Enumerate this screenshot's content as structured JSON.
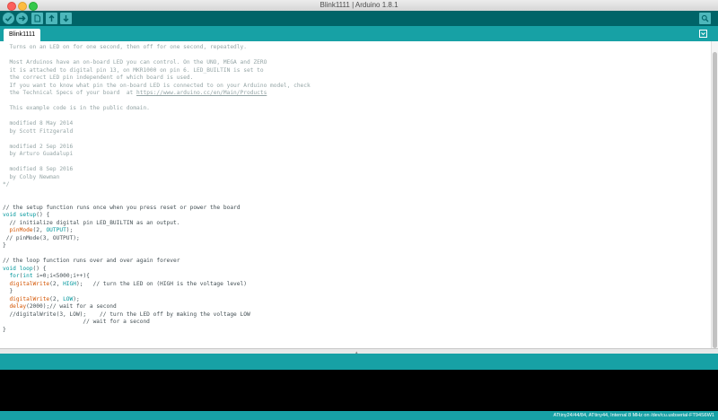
{
  "window": {
    "title": "Blink1111 | Arduino 1.8.1"
  },
  "toolbar": {
    "buttons": [
      {
        "name": "verify",
        "icon": "checkmark-icon"
      },
      {
        "name": "upload",
        "icon": "arrow-right-icon"
      },
      {
        "name": "new",
        "icon": "new-file-icon"
      },
      {
        "name": "open",
        "icon": "arrow-up-icon"
      },
      {
        "name": "save",
        "icon": "arrow-down-icon"
      },
      {
        "name": "serial-monitor",
        "icon": "magnifier-icon"
      }
    ]
  },
  "tabs": [
    {
      "label": "Blink1111"
    }
  ],
  "editor": {
    "lines": [
      {
        "segments": [
          {
            "t": "  Turns on an LED on for one second, then off for one second, repeatedly.",
            "c": "comment"
          }
        ]
      },
      {
        "segments": [
          {
            "t": "",
            "c": "comment"
          }
        ]
      },
      {
        "segments": [
          {
            "t": "  Most Arduinos have an on-board LED you can control. On the UNO, MEGA and ZERO",
            "c": "comment"
          }
        ]
      },
      {
        "segments": [
          {
            "t": "  it is attached to digital pin 13, on MKR1000 on pin 6. LED_BUILTIN is set to",
            "c": "comment"
          }
        ]
      },
      {
        "segments": [
          {
            "t": "  the correct LED pin independent of which board is used.",
            "c": "comment"
          }
        ]
      },
      {
        "segments": [
          {
            "t": "  If you want to know what pin the on-board LED is connected to on your Arduino model, check",
            "c": "comment"
          }
        ]
      },
      {
        "segments": [
          {
            "t": "  the Technical Specs of your board  at ",
            "c": "comment"
          },
          {
            "t": "https://www.arduino.cc/en/Main/Products",
            "c": "comment link"
          }
        ]
      },
      {
        "segments": [
          {
            "t": "",
            "c": "comment"
          }
        ]
      },
      {
        "segments": [
          {
            "t": "  This example code is in the public domain.",
            "c": "comment"
          }
        ]
      },
      {
        "segments": [
          {
            "t": "",
            "c": "comment"
          }
        ]
      },
      {
        "segments": [
          {
            "t": "  modified 8 May 2014",
            "c": "comment"
          }
        ]
      },
      {
        "segments": [
          {
            "t": "  by Scott Fitzgerald",
            "c": "comment"
          }
        ]
      },
      {
        "segments": [
          {
            "t": "",
            "c": "comment"
          }
        ]
      },
      {
        "segments": [
          {
            "t": "  modified 2 Sep 2016",
            "c": "comment"
          }
        ]
      },
      {
        "segments": [
          {
            "t": "  by Arturo Guadalupi",
            "c": "comment"
          }
        ]
      },
      {
        "segments": [
          {
            "t": "",
            "c": "comment"
          }
        ]
      },
      {
        "segments": [
          {
            "t": "  modified 8 Sep 2016",
            "c": "comment"
          }
        ]
      },
      {
        "segments": [
          {
            "t": "  by Colby Newman",
            "c": "comment"
          }
        ]
      },
      {
        "segments": [
          {
            "t": "*/",
            "c": "comment"
          }
        ]
      },
      {
        "segments": [
          {
            "t": "",
            "c": "code"
          }
        ]
      },
      {
        "segments": [
          {
            "t": "",
            "c": "code"
          }
        ]
      },
      {
        "segments": [
          {
            "t": "// the setup function runs once when you press reset or power the board",
            "c": "code"
          }
        ]
      },
      {
        "segments": [
          {
            "t": "void",
            "c": "key"
          },
          {
            "t": " ",
            "c": "code"
          },
          {
            "t": "setup",
            "c": "key"
          },
          {
            "t": "() {",
            "c": "code"
          }
        ]
      },
      {
        "segments": [
          {
            "t": "  // initialize digital pin LED_BUILTIN as an output.",
            "c": "code"
          }
        ]
      },
      {
        "segments": [
          {
            "t": "  ",
            "c": "code"
          },
          {
            "t": "pinMode",
            "c": "fn"
          },
          {
            "t": "(2, ",
            "c": "code"
          },
          {
            "t": "OUTPUT",
            "c": "key"
          },
          {
            "t": ");",
            "c": "code"
          }
        ]
      },
      {
        "segments": [
          {
            "t": " // pinMode(3, OUTPUT);",
            "c": "code"
          }
        ]
      },
      {
        "segments": [
          {
            "t": "}",
            "c": "code"
          }
        ]
      },
      {
        "segments": [
          {
            "t": "",
            "c": "code"
          }
        ]
      },
      {
        "segments": [
          {
            "t": "// the loop function runs over and over again forever",
            "c": "code"
          }
        ]
      },
      {
        "segments": [
          {
            "t": "void",
            "c": "key"
          },
          {
            "t": " ",
            "c": "code"
          },
          {
            "t": "loop",
            "c": "key"
          },
          {
            "t": "() {",
            "c": "code"
          }
        ]
      },
      {
        "segments": [
          {
            "t": "  ",
            "c": "code"
          },
          {
            "t": "for",
            "c": "key"
          },
          {
            "t": "(",
            "c": "code"
          },
          {
            "t": "int",
            "c": "key"
          },
          {
            "t": " i=0;i<5000;i++){",
            "c": "code"
          }
        ]
      },
      {
        "segments": [
          {
            "t": "  ",
            "c": "code"
          },
          {
            "t": "digitalWrite",
            "c": "fn"
          },
          {
            "t": "(2, ",
            "c": "code"
          },
          {
            "t": "HIGH",
            "c": "key"
          },
          {
            "t": ");   // turn the LED on (HIGH is the voltage level)",
            "c": "code"
          }
        ]
      },
      {
        "segments": [
          {
            "t": "  }",
            "c": "code"
          }
        ]
      },
      {
        "segments": [
          {
            "t": "  ",
            "c": "code"
          },
          {
            "t": "digitalWrite",
            "c": "fn"
          },
          {
            "t": "(2, ",
            "c": "code"
          },
          {
            "t": "LOW",
            "c": "key"
          },
          {
            "t": ");",
            "c": "code"
          }
        ]
      },
      {
        "segments": [
          {
            "t": "  ",
            "c": "code"
          },
          {
            "t": "delay",
            "c": "fn"
          },
          {
            "t": "(2000);// wait for a second",
            "c": "code"
          }
        ]
      },
      {
        "segments": [
          {
            "t": "  //digitalWrite(3, LOW);    // turn the LED off by making the voltage LOW",
            "c": "code"
          }
        ]
      },
      {
        "segments": [
          {
            "t": "                        // wait for a second",
            "c": "code"
          }
        ]
      },
      {
        "segments": [
          {
            "t": "}",
            "c": "code"
          }
        ]
      }
    ]
  },
  "status": {
    "text": "ATtiny24/44/84, ATtiny44, Internal 8 MHz on /dev/cu.usbserial-FT94S6W1"
  },
  "colors": {
    "toolbar": "#006468",
    "tabs_bar": "#17a1a5",
    "button": "#4db7bb",
    "comment": "#95a5a6",
    "keyword": "#00979c",
    "function": "#d35400",
    "code": "#434f54",
    "console": "#000000"
  }
}
